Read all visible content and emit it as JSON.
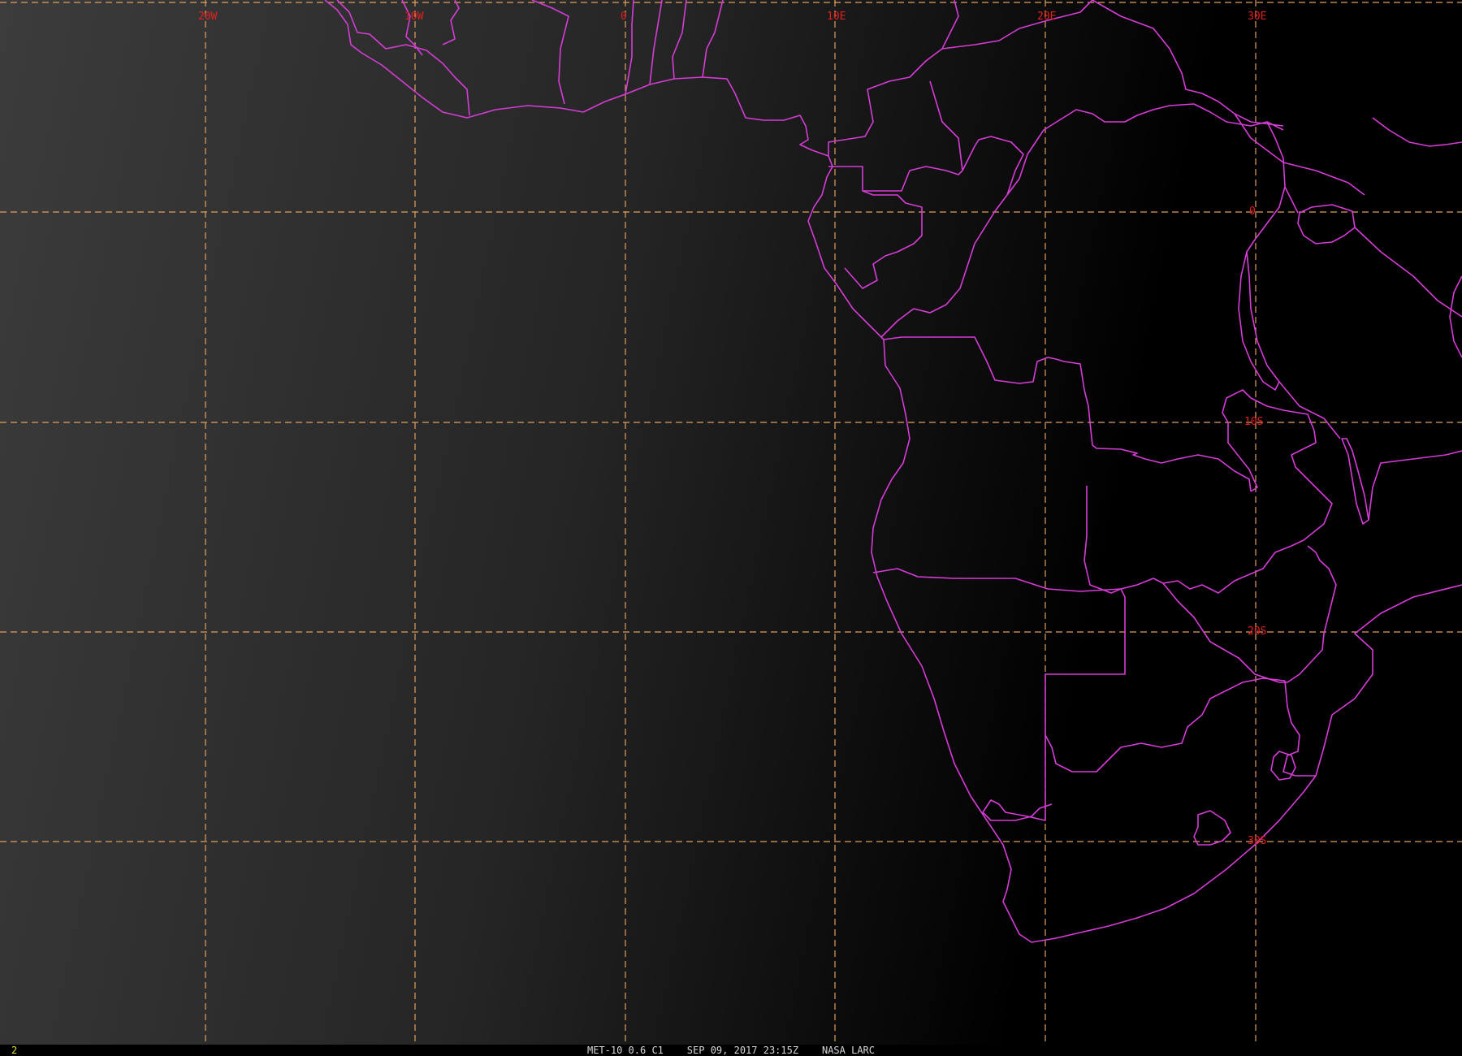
{
  "grid": {
    "lon_labels": [
      "20W",
      "10W",
      "0",
      "10E",
      "20E",
      "30E"
    ],
    "lat_labels": [
      "0",
      "10S",
      "20S",
      "30S"
    ]
  },
  "colors": {
    "grid": "#e0a060",
    "borders": "#d63cd6",
    "labels": "#e02020",
    "frame_number": "#e0e020"
  },
  "status_bar": {
    "frame": "2",
    "caption": "MET-10 0.6 C1    SEP 09, 2017 23:15Z    NASA LARC"
  }
}
